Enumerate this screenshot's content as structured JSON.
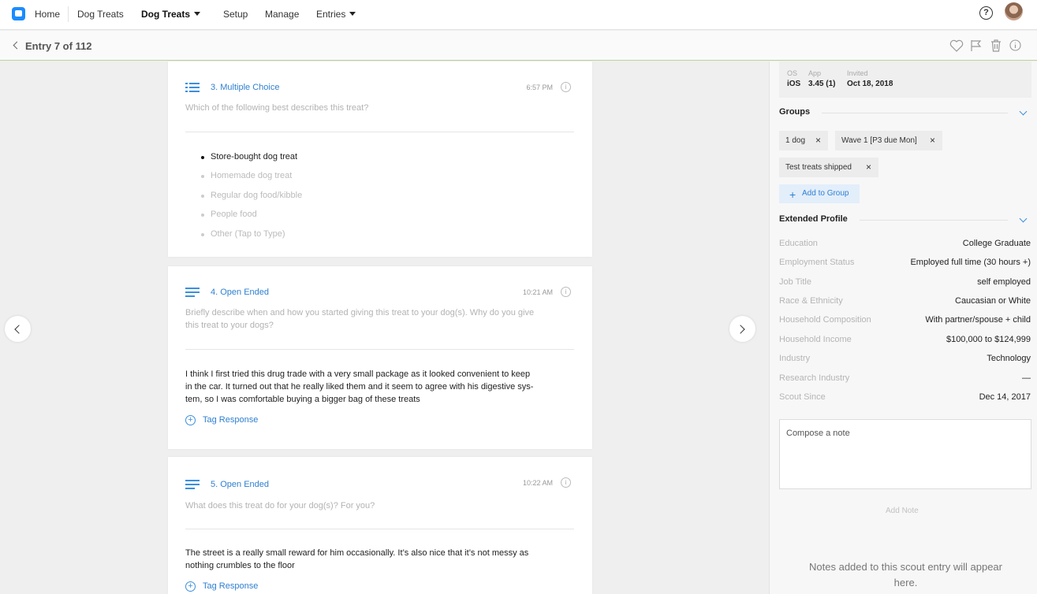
{
  "nav": {
    "home": "Home",
    "dog_treats": "Dog Treats",
    "dog_treats_menu": "Dog Treats",
    "setup": "Setup",
    "manage": "Manage",
    "entries": "Entries",
    "help": "?"
  },
  "entry": {
    "title": "Entry 7 of 112"
  },
  "questions": [
    {
      "title": "3. Multiple Choice",
      "time": "6:57 PM",
      "prompt": "Which of the following best describes this treat?",
      "options": [
        "Store-bought dog treat",
        "Homemade dog treat",
        "Regular dog food/kibble",
        "People food",
        "Other (Tap to Type)"
      ]
    },
    {
      "title": "4. Open Ended",
      "time": "10:21 AM",
      "prompt_line1": "Briefly describe when and how you started giving this treat to your dog(s). Why do you give",
      "prompt_line2": "this treat to your dogs?",
      "answer_line1": "I think I first tried this drug trade with a very small package as it looked convenient to keep",
      "answer_line2": "in the car. It turned out that he really liked them and it seem to agree with his digestive sys-",
      "answer_line3": "tem, so I was comfortable buying a bigger bag of these treats",
      "tag": "Tag Response"
    },
    {
      "title": "5. Open Ended",
      "time": "10:22 AM",
      "prompt": "What does this treat do for your dog(s)? For you?",
      "answer_line1": "The street is a really small reward for him occasionally. It’s also nice that it’s not messy as",
      "answer_line2": "nothing crumbles to the floor",
      "tag": "Tag Response"
    }
  ],
  "meta": {
    "os_label": "OS",
    "os": "iOS",
    "app_label": "App",
    "app": "3.45 (1)",
    "invited_label": "Invited",
    "invited": "Oct 18, 2018"
  },
  "groups": {
    "title": "Groups",
    "chips": [
      "1 dog",
      "Wave 1 [P3 due Mon]",
      "Test treats shipped"
    ],
    "add_label": "Add to Group"
  },
  "profile": {
    "title": "Extended Profile",
    "rows": [
      {
        "label": "Education",
        "value": "College Graduate"
      },
      {
        "label": "Employment Status",
        "value": "Employed full time (30 hours +)"
      },
      {
        "label": "Job Title",
        "value": "self employed"
      },
      {
        "label": "Race & Ethnicity",
        "value": "Caucasian or White"
      },
      {
        "label": "Household Composition",
        "value": "With partner/spouse + child"
      },
      {
        "label": "Household Income",
        "value": "$100,000 to $124,999"
      },
      {
        "label": "Industry",
        "value": "Technology"
      },
      {
        "label": "Research Industry",
        "value": "—"
      },
      {
        "label": "Scout Since",
        "value": "Dec 14, 2017"
      }
    ]
  },
  "notes": {
    "placeholder": "Compose a note",
    "add_label": "Add Note",
    "empty_line1": "Notes added to this scout entry will appear",
    "empty_line2": "here."
  },
  "icons": {
    "logo": "app-logo-icon",
    "help": "help-icon",
    "heart": "heart-icon",
    "flag": "flag-icon",
    "trash": "trash-icon",
    "info": "info-icon",
    "list": "list-icon",
    "plus": "plus-icon",
    "close": "close-icon"
  },
  "colors": {
    "accent": "#2f80d1",
    "divider_green": "#b9d49a",
    "chip_bg": "#ececec"
  }
}
